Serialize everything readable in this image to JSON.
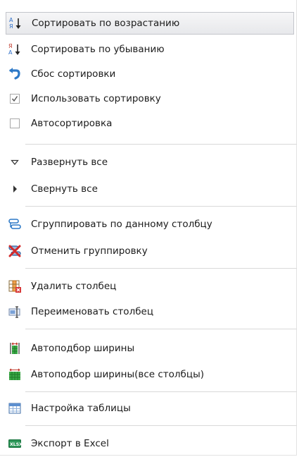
{
  "menu": {
    "items": [
      {
        "label": "Сортировать по возрастанию",
        "icon": "sort-ascending-icon",
        "selected": true
      },
      {
        "label": "Сортировать по убыванию",
        "icon": "sort-descending-icon"
      },
      {
        "label": "Сбос сортировки",
        "icon": "undo-icon"
      },
      {
        "label": "Использовать сортировку",
        "icon": "checkbox-checked-icon",
        "checked": true
      },
      {
        "label": "Автосортировка",
        "icon": "checkbox-empty-icon",
        "checked": false
      },
      {
        "label": "Развернуть все",
        "icon": "triangle-down-icon"
      },
      {
        "label": "Свернуть все",
        "icon": "triangle-right-icon"
      },
      {
        "label": "Сгруппировать по данному столбцу",
        "icon": "group-icon"
      },
      {
        "label": "Отменить группировку",
        "icon": "ungroup-icon"
      },
      {
        "label": "Удалить столбец",
        "icon": "delete-column-icon"
      },
      {
        "label": "Переименовать столбец",
        "icon": "rename-column-icon"
      },
      {
        "label": "Автоподбор ширины",
        "icon": "autofit-column-icon"
      },
      {
        "label": "Автоподбор ширины(все столбцы)",
        "icon": "autofit-all-columns-icon"
      },
      {
        "label": "Настройка таблицы",
        "icon": "table-settings-icon"
      },
      {
        "label": "Экспорт в Excel",
        "icon": "excel-export-icon"
      }
    ]
  },
  "colors": {
    "highlight_border": "#c3c5cb",
    "separator": "#d9d9d9",
    "text": "#1b1b1b"
  }
}
